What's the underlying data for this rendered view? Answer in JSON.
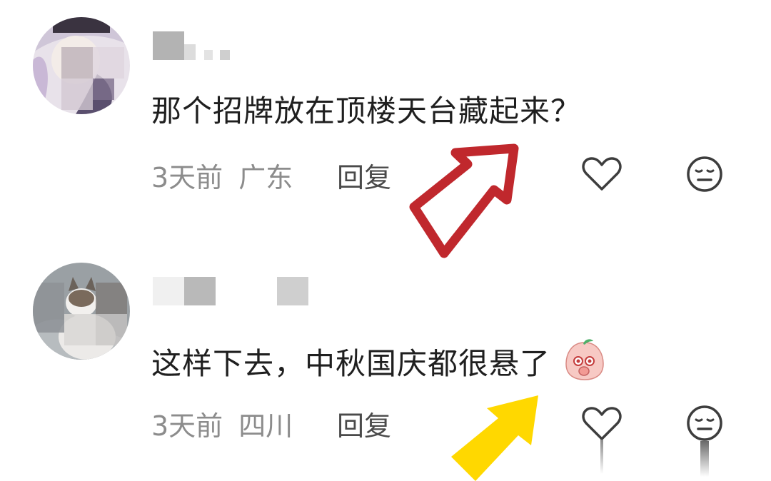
{
  "comments": [
    {
      "text": "那个招牌放在顶楼天台藏起来？",
      "time": "3天前",
      "location": "广东",
      "reply_label": "回复",
      "has_emoji": false
    },
    {
      "text": "这样下去，中秋国庆都很悬了",
      "time": "3天前",
      "location": "四川",
      "reply_label": "回复",
      "has_emoji": true,
      "emoji": "peach-face-emoji"
    }
  ],
  "icons": {
    "like": "heart-outline-icon",
    "dislike": "meh-face-icon"
  },
  "colors": {
    "text": "#1f1f1f",
    "meta": "#8c8c8c",
    "reply": "#4a4a4a",
    "arrow_red": "#c0282d",
    "arrow_yellow": "#ffd800"
  }
}
